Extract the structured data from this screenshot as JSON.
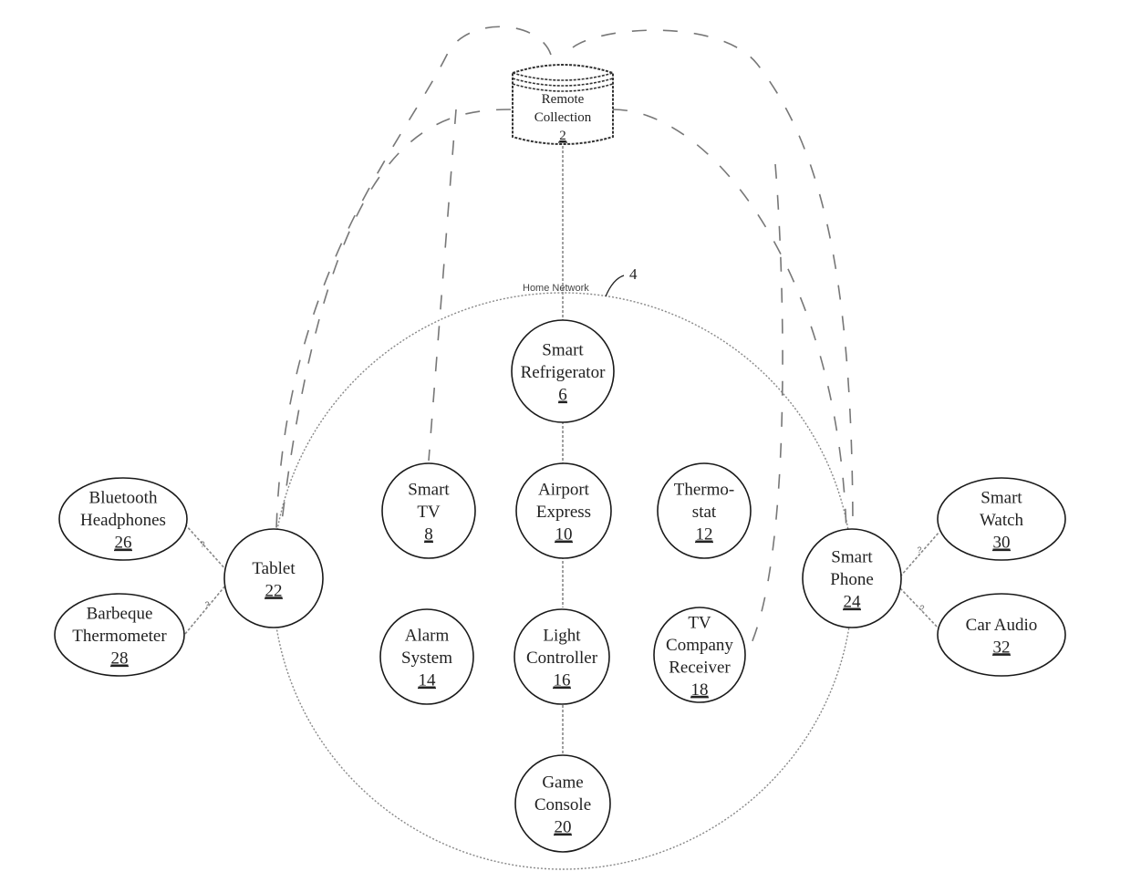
{
  "remote_collection": {
    "line1": "Remote",
    "line2": "Collection",
    "number": "2"
  },
  "home_network": {
    "label": "Home Network",
    "ref": "4"
  },
  "nodes": {
    "smart_refrigerator": {
      "lines": [
        "Smart",
        "Refrigerator"
      ],
      "number": "6"
    },
    "smart_tv": {
      "lines": [
        "Smart",
        "TV"
      ],
      "number": "8"
    },
    "airport_express": {
      "lines": [
        "Airport",
        "Express"
      ],
      "number": "10"
    },
    "thermostat": {
      "lines": [
        "Thermo-",
        "stat"
      ],
      "number": "12"
    },
    "alarm_system": {
      "lines": [
        "Alarm",
        "System"
      ],
      "number": "14"
    },
    "light_controller": {
      "lines": [
        "Light",
        "Controller"
      ],
      "number": "16"
    },
    "tv_company_receiver": {
      "lines": [
        "TV",
        "Company",
        "Receiver"
      ],
      "number": "18"
    },
    "game_console": {
      "lines": [
        "Game",
        "Console"
      ],
      "number": "20"
    },
    "tablet": {
      "lines": [
        "Tablet"
      ],
      "number": "22"
    },
    "smart_phone": {
      "lines": [
        "Smart",
        "Phone"
      ],
      "number": "24"
    },
    "bluetooth_headphones": {
      "lines": [
        "Bluetooth",
        "Headphones"
      ],
      "number": "26"
    },
    "barbeque_thermometer": {
      "lines": [
        "Barbeque",
        "Thermometer"
      ],
      "number": "28"
    },
    "smart_watch": {
      "lines": [
        "Smart",
        "Watch"
      ],
      "number": "30"
    },
    "car_audio": {
      "lines": [
        "Car Audio"
      ],
      "number": "32"
    }
  },
  "link_marks": {
    "unknown": "?"
  }
}
